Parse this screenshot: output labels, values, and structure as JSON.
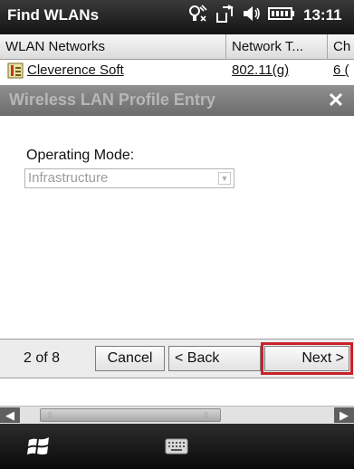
{
  "statusbar": {
    "title": "Find WLANs",
    "time": "13:11",
    "icons": [
      "signal-icon",
      "connectivity-icon",
      "volume-icon",
      "battery-icon"
    ]
  },
  "list": {
    "columns": [
      "WLAN Networks",
      "Network T...",
      "Ch"
    ],
    "rows": [
      {
        "name": "Cleverence Soft",
        "network_type": "802.11(g)",
        "channel": "6 ("
      }
    ]
  },
  "dialog": {
    "title": "Wireless LAN Profile Entry",
    "close_label": "✕",
    "operating_mode": {
      "label": "Operating Mode:",
      "value": "Infrastructure"
    }
  },
  "wizard": {
    "page": "2 of 8",
    "cancel_label": "Cancel",
    "back_label": "< Back",
    "next_label": "Next >"
  },
  "colors": {
    "highlight": "#c8222a",
    "title_bar": "#141414",
    "dialog_title_bg": "#7a7a7a"
  }
}
